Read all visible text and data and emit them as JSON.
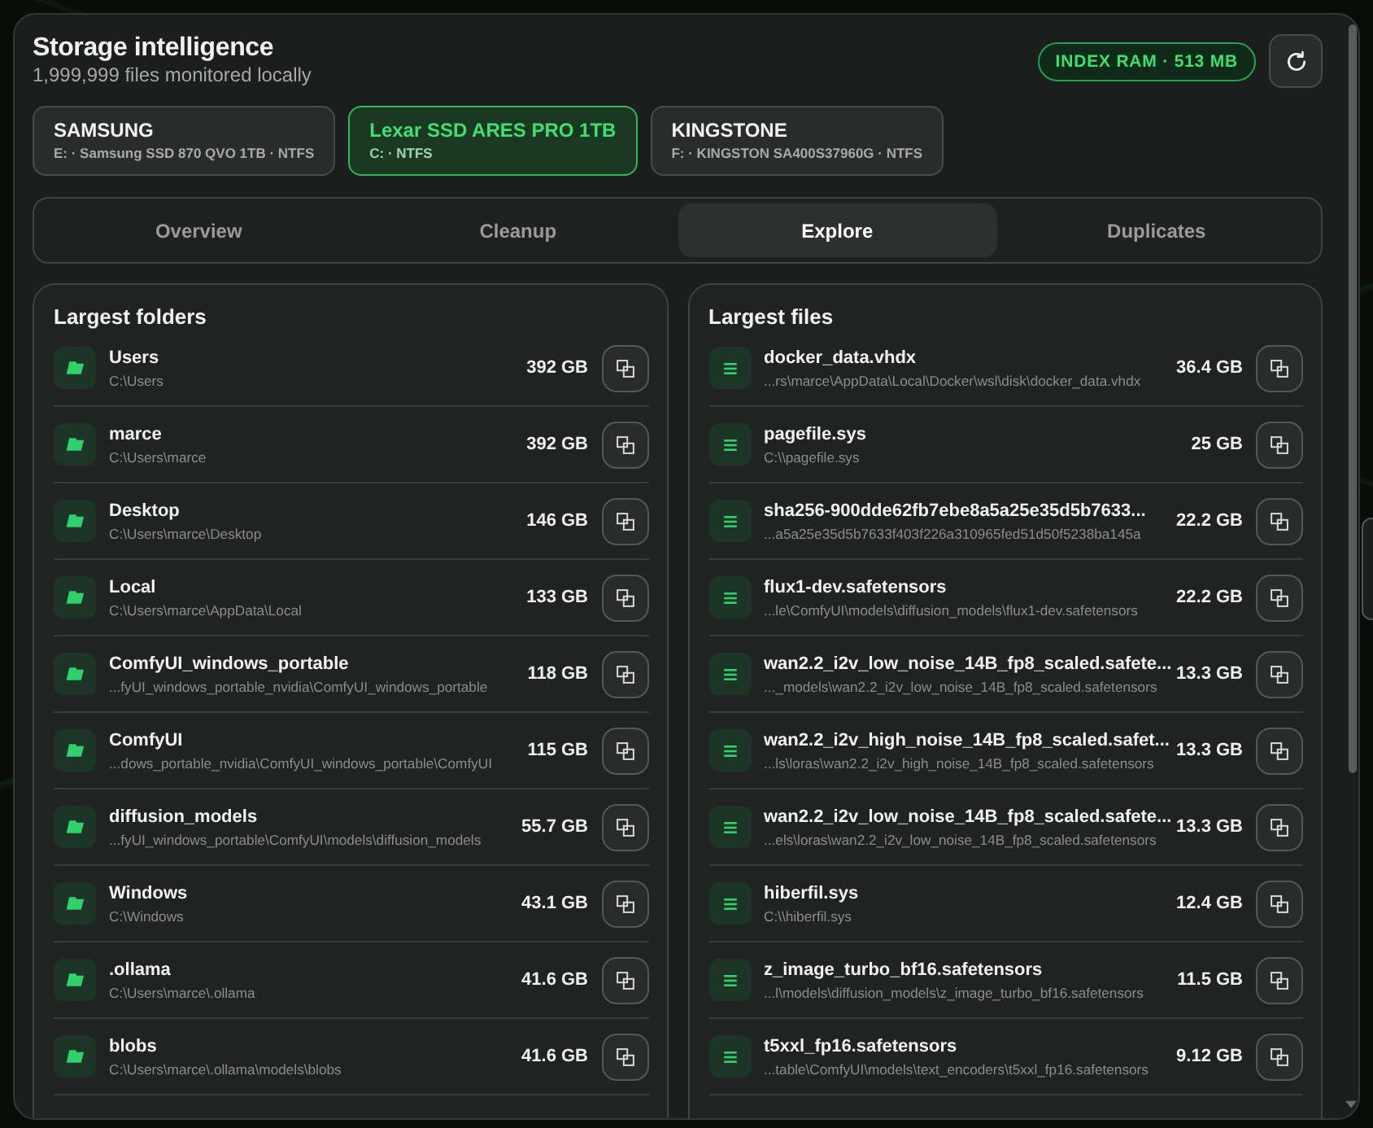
{
  "window": {
    "title": "Storage intelligence",
    "subtitle": "1,999,999 files monitored locally",
    "badge": "INDEX RAM · 513 MB"
  },
  "drives": [
    {
      "name": "SAMSUNG",
      "details": "E: · Samsung SSD 870 QVO 1TB · NTFS",
      "selected": false
    },
    {
      "name": "Lexar SSD ARES PRO 1TB",
      "details": "C: · NTFS",
      "selected": true
    },
    {
      "name": "KINGSTONE",
      "details": "F: · KINGSTON SA400S37960G · NTFS",
      "selected": false
    }
  ],
  "tabs": [
    {
      "label": "Overview",
      "selected": false
    },
    {
      "label": "Cleanup",
      "selected": false
    },
    {
      "label": "Explore",
      "selected": true
    },
    {
      "label": "Duplicates",
      "selected": false
    }
  ],
  "panels": [
    {
      "title": "Largest folders",
      "kind": "folder",
      "rows": [
        {
          "name": "Users",
          "path": "C:\\Users",
          "size": "392 GB"
        },
        {
          "name": "marce",
          "path": "C:\\Users\\marce",
          "size": "392 GB"
        },
        {
          "name": "Desktop",
          "path": "C:\\Users\\marce\\Desktop",
          "size": "146 GB"
        },
        {
          "name": "Local",
          "path": "C:\\Users\\marce\\AppData\\Local",
          "size": "133 GB"
        },
        {
          "name": "ComfyUI_windows_portable",
          "path": "...fyUI_windows_portable_nvidia\\ComfyUI_windows_portable",
          "size": "118 GB"
        },
        {
          "name": "ComfyUI",
          "path": "...dows_portable_nvidia\\ComfyUI_windows_portable\\ComfyUI",
          "size": "115 GB"
        },
        {
          "name": "diffusion_models",
          "path": "...fyUI_windows_portable\\ComfyUI\\models\\diffusion_models",
          "size": "55.7 GB"
        },
        {
          "name": "Windows",
          "path": "C:\\Windows",
          "size": "43.1 GB"
        },
        {
          "name": ".ollama",
          "path": "C:\\Users\\marce\\.ollama",
          "size": "41.6 GB"
        },
        {
          "name": "blobs",
          "path": "C:\\Users\\marce\\.ollama\\models\\blobs",
          "size": "41.6 GB"
        }
      ]
    },
    {
      "title": "Largest files",
      "kind": "file",
      "rows": [
        {
          "name": "docker_data.vhdx",
          "path": "...rs\\marce\\AppData\\Local\\Docker\\wsl\\disk\\docker_data.vhdx",
          "size": "36.4 GB"
        },
        {
          "name": "pagefile.sys",
          "path": "C:\\\\pagefile.sys",
          "size": "25 GB"
        },
        {
          "name": "sha256-900dde62fb7ebe8a5a25e35d5b7633...",
          "path": "...a5a25e35d5b7633f403f226a310965fed51d50f5238ba145a",
          "size": "22.2 GB"
        },
        {
          "name": "flux1-dev.safetensors",
          "path": "...le\\ComfyUI\\models\\diffusion_models\\flux1-dev.safetensors",
          "size": "22.2 GB"
        },
        {
          "name": "wan2.2_i2v_low_noise_14B_fp8_scaled.safete...",
          "path": "..._models\\wan2.2_i2v_low_noise_14B_fp8_scaled.safetensors",
          "size": "13.3 GB"
        },
        {
          "name": "wan2.2_i2v_high_noise_14B_fp8_scaled.safet...",
          "path": "...ls\\loras\\wan2.2_i2v_high_noise_14B_fp8_scaled.safetensors",
          "size": "13.3 GB"
        },
        {
          "name": "wan2.2_i2v_low_noise_14B_fp8_scaled.safete...",
          "path": "...els\\loras\\wan2.2_i2v_low_noise_14B_fp8_scaled.safetensors",
          "size": "13.3 GB"
        },
        {
          "name": "hiberfil.sys",
          "path": "C:\\\\hiberfil.sys",
          "size": "12.4 GB"
        },
        {
          "name": "z_image_turbo_bf16.safetensors",
          "path": "...l\\models\\diffusion_models\\z_image_turbo_bf16.safetensors",
          "size": "11.5 GB"
        },
        {
          "name": "t5xxl_fp16.safetensors",
          "path": "...table\\ComfyUI\\models\\text_encoders\\t5xxl_fp16.safetensors",
          "size": "9.12 GB"
        }
      ]
    }
  ]
}
